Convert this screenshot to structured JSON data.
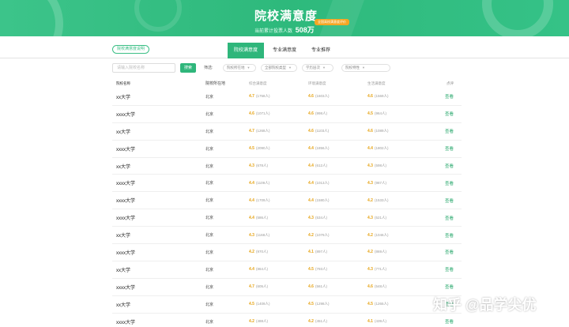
{
  "banner": {
    "title": "院校满意度",
    "subtitle": "当前累计投票人数",
    "voter_count": "508万",
    "badge": "全国高校满意度评价"
  },
  "tabs": {
    "help_label": "院校满意度说明",
    "items": [
      {
        "label": "院校满意度",
        "active": true
      },
      {
        "label": "专业满意度",
        "active": false
      },
      {
        "label": "专业推荐",
        "active": false
      }
    ]
  },
  "filters": {
    "search_placeholder": "请输入院校名称",
    "search_button": "搜索",
    "filter_label": "筛选:",
    "dropdowns": [
      "院校所在地",
      "全部院校类型",
      "学历层次",
      "院校特性"
    ]
  },
  "table": {
    "headers": [
      "院校名称",
      "院校所在地",
      "综合满意度",
      "环境满意度",
      "生活满意度",
      "点评"
    ],
    "rows": [
      {
        "name": "xx大学",
        "loc": "北京",
        "s1": "4.7",
        "n1": "(1758人)",
        "s2": "4.6",
        "n2": "(1603人)",
        "s3": "4.6",
        "n3": "(1569人)",
        "action": "查看"
      },
      {
        "name": "xxxx大学",
        "loc": "北京",
        "s1": "4.6",
        "n1": "(1071人)",
        "s2": "4.6",
        "n2": "(998人)",
        "s3": "4.5",
        "n3": "(964人)",
        "action": "查看"
      },
      {
        "name": "xx大学",
        "loc": "北京",
        "s1": "4.7",
        "n1": "(1268人)",
        "s2": "4.6",
        "n2": "(1103人)",
        "s3": "4.6",
        "n3": "(1089人)",
        "action": "查看"
      },
      {
        "name": "xxxx大学",
        "loc": "北京",
        "s1": "4.5",
        "n1": "(2090人)",
        "s2": "4.4",
        "n2": "(1856人)",
        "s3": "4.4",
        "n3": "(1802人)",
        "action": "查看"
      },
      {
        "name": "xx大学",
        "loc": "北京",
        "s1": "4.3",
        "n1": "(678人)",
        "s2": "4.4",
        "n2": "(612人)",
        "s3": "4.3",
        "n3": "(598人)",
        "action": "查看"
      },
      {
        "name": "xxxx大学",
        "loc": "北京",
        "s1": "4.4",
        "n1": "(1109人)",
        "s2": "4.4",
        "n2": "(1013人)",
        "s3": "4.3",
        "n3": "(987人)",
        "action": "查看"
      },
      {
        "name": "xxxx大学",
        "loc": "北京",
        "s1": "4.4",
        "n1": "(1709人)",
        "s2": "4.4",
        "n2": "(1580人)",
        "s3": "4.2",
        "n3": "(1533人)",
        "action": "查看"
      },
      {
        "name": "xxxx大学",
        "loc": "北京",
        "s1": "4.4",
        "n1": "(586人)",
        "s2": "4.3",
        "n2": "(534人)",
        "s3": "4.3",
        "n3": "(521人)",
        "action": "查看"
      },
      {
        "name": "xx大学",
        "loc": "北京",
        "s1": "4.3",
        "n1": "(1168人)",
        "s2": "4.2",
        "n2": "(1079人)",
        "s3": "4.2",
        "n3": "(1046人)",
        "action": "查看"
      },
      {
        "name": "xxxx大学",
        "loc": "北京",
        "s1": "4.2",
        "n1": "(970人)",
        "s2": "4.1",
        "n2": "(897人)",
        "s3": "4.2",
        "n3": "(869人)",
        "action": "查看"
      },
      {
        "name": "xx大学",
        "loc": "北京",
        "s1": "4.4",
        "n1": "(864人)",
        "s2": "4.5",
        "n2": "(793人)",
        "s3": "4.3",
        "n3": "(771人)",
        "action": "查看"
      },
      {
        "name": "xxxx大学",
        "loc": "北京",
        "s1": "4.7",
        "n1": "(605人)",
        "s2": "4.6",
        "n2": "(561人)",
        "s3": "4.6",
        "n3": "(548人)",
        "action": "查看"
      },
      {
        "name": "xx大学",
        "loc": "北京",
        "s1": "4.5",
        "n1": "(1409人)",
        "s2": "4.5",
        "n2": "(1298人)",
        "s3": "4.5",
        "n3": "(1265人)",
        "action": "查看"
      },
      {
        "name": "xxxx大学",
        "loc": "北京",
        "s1": "4.2",
        "n1": "(488人)",
        "s2": "4.2",
        "n2": "(451人)",
        "s3": "4.1",
        "n3": "(439人)",
        "action": "查看"
      }
    ]
  },
  "watermark": "知乎 @品学尖优"
}
